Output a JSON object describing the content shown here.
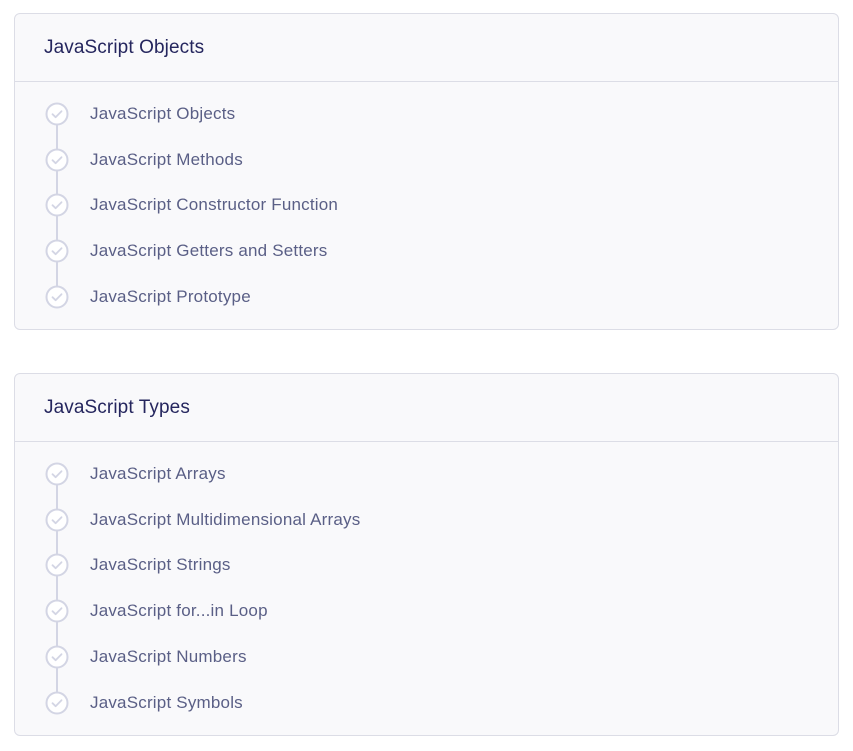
{
  "sections": [
    {
      "title": "JavaScript Objects",
      "items": [
        {
          "label": "JavaScript Objects"
        },
        {
          "label": "JavaScript Methods"
        },
        {
          "label": "JavaScript Constructor Function"
        },
        {
          "label": "JavaScript Getters and Setters"
        },
        {
          "label": "JavaScript Prototype"
        }
      ]
    },
    {
      "title": "JavaScript Types",
      "items": [
        {
          "label": "JavaScript Arrays"
        },
        {
          "label": "JavaScript Multidimensional Arrays"
        },
        {
          "label": "JavaScript Strings"
        },
        {
          "label": "JavaScript for...in Loop"
        },
        {
          "label": "JavaScript Numbers"
        },
        {
          "label": "JavaScript Symbols"
        }
      ]
    }
  ],
  "colors": {
    "card_background": "#f9f9fb",
    "border": "#dcdde6",
    "title_text": "#25265e",
    "item_text": "#5a5f86",
    "check_icon": "#d3d5e4"
  },
  "icons": {
    "item_status": "check-circle-icon"
  }
}
